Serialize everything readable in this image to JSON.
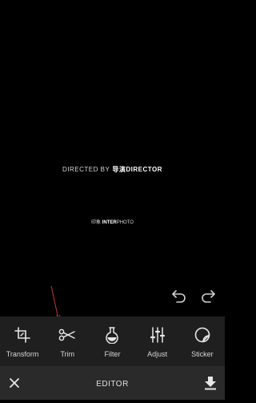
{
  "preview": {
    "directed_by": "DIRECTED BY",
    "brand_prefix": "导演",
    "brand_name": "DIRECTOR",
    "interphoto_prefix": "印象",
    "interphoto_bold": "INTER",
    "interphoto_rest": "PHOTO"
  },
  "toolbar": {
    "items": [
      {
        "label": "Transform",
        "icon": "crop-icon"
      },
      {
        "label": "Trim",
        "icon": "scissors-icon"
      },
      {
        "label": "Filter",
        "icon": "flask-icon"
      },
      {
        "label": "Adjust",
        "icon": "sliders-icon"
      },
      {
        "label": "Sticker",
        "icon": "sticker-icon"
      }
    ]
  },
  "bottombar": {
    "title": "EDITOR",
    "close_icon": "close-icon",
    "download_icon": "download-icon"
  },
  "colors": {
    "background": "#000000",
    "toolbar": "#1f1f1f",
    "bottombar": "#2a2a2a",
    "annotation": "#c0392b"
  }
}
